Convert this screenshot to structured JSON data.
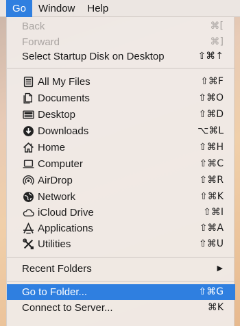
{
  "menubar": {
    "go": "Go",
    "window": "Window",
    "help": "Help"
  },
  "colors": {
    "accent": "#2f7fe0",
    "menu_bg": "#f0ebe8",
    "disabled_text": "#a9a4a1"
  },
  "menu": {
    "back": {
      "label": "Back",
      "shortcut": "⌘["
    },
    "forward": {
      "label": "Forward",
      "shortcut": "⌘]"
    },
    "startup": {
      "label": "Select Startup Disk on Desktop",
      "shortcut": "⇧⌘↑"
    },
    "items": [
      {
        "label": "All My Files",
        "shortcut": "⇧⌘F",
        "icon": "all-my-files-icon"
      },
      {
        "label": "Documents",
        "shortcut": "⇧⌘O",
        "icon": "documents-icon"
      },
      {
        "label": "Desktop",
        "shortcut": "⇧⌘D",
        "icon": "desktop-icon"
      },
      {
        "label": "Downloads",
        "shortcut": "⌥⌘L",
        "icon": "downloads-icon"
      },
      {
        "label": "Home",
        "shortcut": "⇧⌘H",
        "icon": "home-icon"
      },
      {
        "label": "Computer",
        "shortcut": "⇧⌘C",
        "icon": "computer-icon"
      },
      {
        "label": "AirDrop",
        "shortcut": "⇧⌘R",
        "icon": "airdrop-icon"
      },
      {
        "label": "Network",
        "shortcut": "⇧⌘K",
        "icon": "network-icon"
      },
      {
        "label": "iCloud Drive",
        "shortcut": "⇧⌘I",
        "icon": "icloud-icon"
      },
      {
        "label": "Applications",
        "shortcut": "⇧⌘A",
        "icon": "applications-icon"
      },
      {
        "label": "Utilities",
        "shortcut": "⇧⌘U",
        "icon": "utilities-icon"
      }
    ],
    "recent": {
      "label": "Recent Folders",
      "arrow": "▶"
    },
    "goto": {
      "label": "Go to Folder...",
      "shortcut": "⇧⌘G"
    },
    "connect": {
      "label": "Connect to Server...",
      "shortcut": "⌘K"
    }
  }
}
